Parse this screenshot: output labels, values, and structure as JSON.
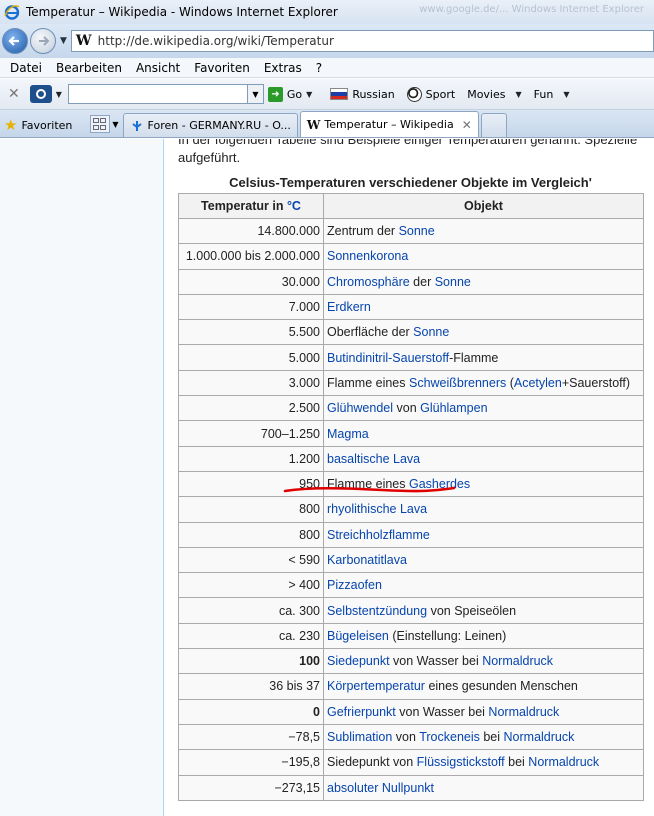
{
  "window": {
    "title": "Temperatur – Wikipedia - Windows Internet Explorer",
    "ghost_text": "www.google.de/...  Windows Internet Explorer"
  },
  "address": {
    "url": "http://de.wikipedia.org/wiki/Temperatur",
    "site_glyph": "W"
  },
  "menu": {
    "items": [
      "Datei",
      "Bearbeiten",
      "Ansicht",
      "Favoriten",
      "Extras",
      "?"
    ]
  },
  "toolbar": {
    "search_value": "",
    "go": "Go",
    "russian": "Russian",
    "sport": "Sport",
    "movies": "Movies",
    "fun": "Fun"
  },
  "tabs": {
    "favorites": "Favoriten",
    "tab1": "Foren - GERMANY.RU - O...",
    "tab2": "Temperatur – Wikipedia"
  },
  "article": {
    "intro": "In der folgenden Tabelle sind Beispiele einiger Temperaturen genannt. Spezielle aufgeführt.",
    "caption": "Celsius-Temperaturen verschiedener Objekte im Vergleich'",
    "header_temp": "Temperatur in ",
    "header_unit": "°C",
    "header_obj": "Objekt"
  },
  "rows": [
    {
      "t": "14.800.000",
      "o": [
        [
          "Zentrum der ",
          0
        ],
        [
          "Sonne",
          1
        ]
      ]
    },
    {
      "t": "1.000.000 bis 2.000.000",
      "o": [
        [
          "Sonnenkorona",
          1
        ]
      ]
    },
    {
      "t": "30.000",
      "o": [
        [
          "Chromosphäre",
          1
        ],
        [
          " der ",
          0
        ],
        [
          "Sonne",
          1
        ]
      ]
    },
    {
      "t": "7.000",
      "o": [
        [
          "Erdkern",
          1
        ]
      ]
    },
    {
      "t": "5.500",
      "o": [
        [
          "Oberfläche der ",
          0
        ],
        [
          "Sonne",
          1
        ]
      ]
    },
    {
      "t": "5.000",
      "o": [
        [
          "Butindinitril-Sauerstoff",
          1
        ],
        [
          "-Flamme",
          0
        ]
      ]
    },
    {
      "t": "3.000",
      "o": [
        [
          "Flamme eines ",
          0
        ],
        [
          "Schweißbrenners",
          1
        ],
        [
          " (",
          0
        ],
        [
          "Acetylen",
          1
        ],
        [
          "+Sauerstoff)",
          0
        ]
      ]
    },
    {
      "t": "2.500",
      "o": [
        [
          "Glühwendel",
          1
        ],
        [
          " von ",
          0
        ],
        [
          "Glühlampen",
          1
        ]
      ]
    },
    {
      "t": "700–1.250",
      "o": [
        [
          "Magma",
          1
        ]
      ]
    },
    {
      "t": "1.200",
      "o": [
        [
          "basaltische Lava",
          1
        ]
      ]
    },
    {
      "t": "950",
      "o": [
        [
          "Flamme eines ",
          0
        ],
        [
          "Gasherdes",
          1
        ]
      ]
    },
    {
      "t": "800",
      "o": [
        [
          "rhyolithische Lava",
          1
        ]
      ]
    },
    {
      "t": "800",
      "o": [
        [
          "Streichholzflamme",
          1
        ]
      ]
    },
    {
      "t": "< 590",
      "o": [
        [
          "Karbonatitlava",
          1
        ]
      ]
    },
    {
      "t": "> 400",
      "o": [
        [
          "Pizzaofen",
          1
        ]
      ]
    },
    {
      "t": "ca. 300",
      "o": [
        [
          "Selbstentzündung",
          1
        ],
        [
          " von Speiseölen",
          0
        ]
      ]
    },
    {
      "t": "ca. 230",
      "o": [
        [
          "Bügeleisen",
          1
        ],
        [
          " (Einstellung: Leinen)",
          0
        ]
      ]
    },
    {
      "t": "100",
      "bold": true,
      "o": [
        [
          "Siedepunkt",
          1
        ],
        [
          " von Wasser bei ",
          0
        ],
        [
          "Normaldruck",
          1
        ]
      ]
    },
    {
      "t": "36 bis 37",
      "o": [
        [
          "Körpertemperatur",
          1
        ],
        [
          " eines gesunden Menschen",
          0
        ]
      ]
    },
    {
      "t": "0",
      "bold": true,
      "o": [
        [
          "Gefrierpunkt",
          1
        ],
        [
          " von Wasser bei ",
          0
        ],
        [
          "Normaldruck",
          1
        ]
      ]
    },
    {
      "t": "−78,5",
      "o": [
        [
          "Sublimation",
          1
        ],
        [
          " von ",
          0
        ],
        [
          "Trockeneis",
          1
        ],
        [
          " bei ",
          0
        ],
        [
          "Normaldruck",
          1
        ]
      ]
    },
    {
      "t": "−195,8",
      "o": [
        [
          "Siedepunkt von ",
          0
        ],
        [
          "Flüssigstickstoff",
          1
        ],
        [
          " bei ",
          0
        ],
        [
          "Normaldruck",
          1
        ]
      ]
    },
    {
      "t": "−273,15",
      "o": [
        [
          "absoluter Nullpunkt",
          1
        ]
      ]
    }
  ],
  "colors": {
    "link": "#0645ad",
    "annotation": "#e00000"
  }
}
